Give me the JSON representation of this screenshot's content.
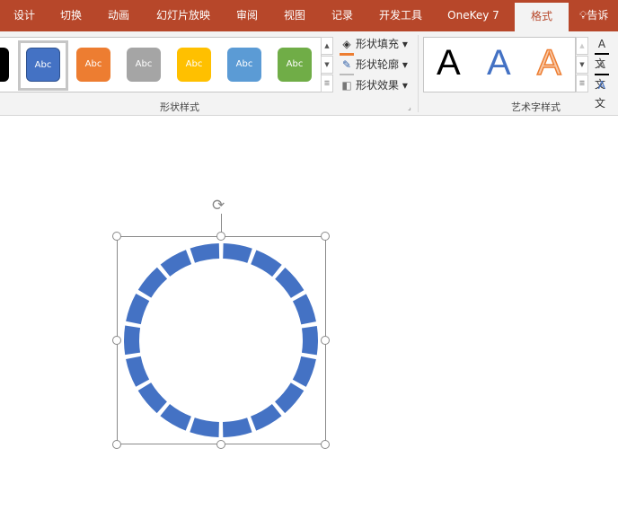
{
  "tabs": [
    {
      "label": "设计"
    },
    {
      "label": "切换"
    },
    {
      "label": "动画"
    },
    {
      "label": "幻灯片放映"
    },
    {
      "label": "审阅"
    },
    {
      "label": "视图"
    },
    {
      "label": "记录"
    },
    {
      "label": "开发工具"
    },
    {
      "label": "OneKey 7"
    },
    {
      "label": "格式",
      "active": true
    },
    {
      "label": "告诉"
    }
  ],
  "shape_styles": {
    "swatches": [
      {
        "label": "Abc",
        "color": "#000000"
      },
      {
        "label": "Abc",
        "color": "#4472c4"
      },
      {
        "label": "Abc",
        "color": "#ed7d31"
      },
      {
        "label": "Abc",
        "color": "#a5a5a5"
      },
      {
        "label": "Abc",
        "color": "#ffc000"
      },
      {
        "label": "Abc",
        "color": "#5b9bd5"
      },
      {
        "label": "Abc",
        "color": "#70ad47"
      }
    ],
    "commands": [
      {
        "label": "形状填充"
      },
      {
        "label": "形状轮廓"
      },
      {
        "label": "形状效果"
      }
    ],
    "group_label": "形状样式"
  },
  "wordart": {
    "samples": [
      {
        "label": "A"
      },
      {
        "label": "A"
      },
      {
        "label": "A"
      }
    ],
    "commands": [
      {
        "label": "文"
      },
      {
        "label": "文"
      },
      {
        "label": "文"
      }
    ],
    "group_label": "艺术字样式"
  },
  "shape": {
    "segments": 18,
    "fill": "#4472c4"
  }
}
